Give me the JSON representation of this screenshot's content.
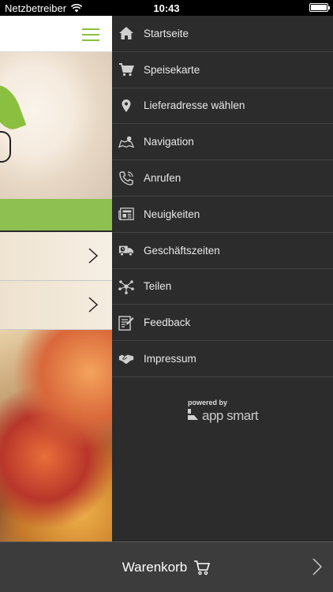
{
  "status_bar": {
    "carrier": "Netzbetreiber",
    "time": "10:43"
  },
  "menu": {
    "items": [
      {
        "label": "Startseite",
        "icon": "home-icon"
      },
      {
        "label": "Speisekarte",
        "icon": "cart-icon"
      },
      {
        "label": "Lieferadresse wählen",
        "icon": "location-pin-icon"
      },
      {
        "label": "Navigation",
        "icon": "map-icon"
      },
      {
        "label": "Anrufen",
        "icon": "phone-icon"
      },
      {
        "label": "Neuigkeiten",
        "icon": "newspaper-icon"
      },
      {
        "label": "Geschäftszeiten",
        "icon": "delivery-truck-icon"
      },
      {
        "label": "Teilen",
        "icon": "share-icon"
      },
      {
        "label": "Feedback",
        "icon": "feedback-icon"
      },
      {
        "label": "Impressum",
        "icon": "handshake-icon"
      }
    ],
    "powered_by": "powered by",
    "brand": "app smart"
  },
  "cart_bar": {
    "label": "Warenkorb"
  },
  "colors": {
    "accent": "#8dc050",
    "menu_bg": "#2c2c2c",
    "cart_bar_bg": "#3c3c3c"
  }
}
